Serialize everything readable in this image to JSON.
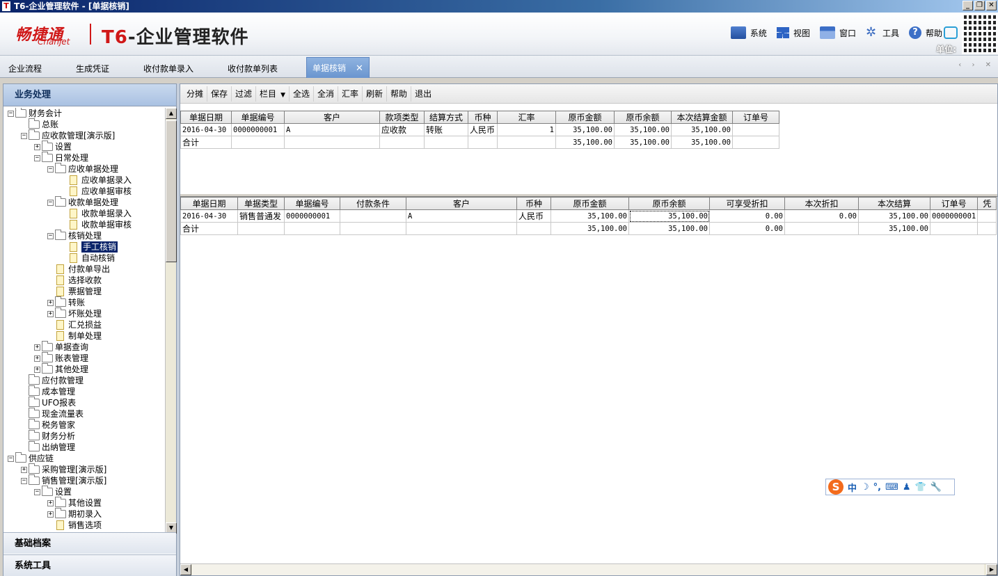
{
  "window": {
    "title": "T6-企业管理软件 - [单据核销]",
    "app_icon": "T",
    "controls": {
      "minimize": "_",
      "restore": "❐",
      "close": "✕"
    }
  },
  "header": {
    "brand_cn": "畅捷通",
    "brand_en": "Chanjet",
    "product_prefix": "T6",
    "product_suffix": "-企业管理软件",
    "menu": [
      {
        "label": "系统",
        "icon": "system-icon"
      },
      {
        "label": "视图",
        "icon": "view-icon"
      },
      {
        "label": "窗口",
        "icon": "window-icon"
      },
      {
        "label": "工具",
        "icon": "tools-icon"
      },
      {
        "label": "帮助",
        "icon": "help-icon"
      }
    ],
    "unit_label": "单位:"
  },
  "tabs": [
    {
      "label": "企业流程"
    },
    {
      "label": "生成凭证"
    },
    {
      "label": "收付款单录入"
    },
    {
      "label": "收付款单列表"
    },
    {
      "label": "单据核销",
      "active": true,
      "close": "✕"
    }
  ],
  "tab_nav": "‹ › ✕",
  "left_panel": {
    "header": "业务处理",
    "tree": [
      {
        "label": "财务会计",
        "level": 0,
        "exp": "-",
        "icon": "folder"
      },
      {
        "label": "总账",
        "level": 1,
        "exp": "",
        "icon": "folder"
      },
      {
        "label": "应收款管理[演示版]",
        "level": 1,
        "exp": "-",
        "icon": "folder"
      },
      {
        "label": "设置",
        "level": 2,
        "exp": "+",
        "icon": "folder"
      },
      {
        "label": "日常处理",
        "level": 2,
        "exp": "-",
        "icon": "folder"
      },
      {
        "label": "应收单据处理",
        "level": 3,
        "exp": "-",
        "icon": "folder"
      },
      {
        "label": "应收单据录入",
        "level": 4,
        "exp": "",
        "icon": "doc"
      },
      {
        "label": "应收单据审核",
        "level": 4,
        "exp": "",
        "icon": "doc"
      },
      {
        "label": "收款单据处理",
        "level": 3,
        "exp": "-",
        "icon": "folder"
      },
      {
        "label": "收款单据录入",
        "level": 4,
        "exp": "",
        "icon": "doc"
      },
      {
        "label": "收款单据审核",
        "level": 4,
        "exp": "",
        "icon": "doc"
      },
      {
        "label": "核销处理",
        "level": 3,
        "exp": "-",
        "icon": "folder"
      },
      {
        "label": "手工核销",
        "level": 4,
        "exp": "",
        "icon": "doc",
        "selected": true
      },
      {
        "label": "自动核销",
        "level": 4,
        "exp": "",
        "icon": "doc"
      },
      {
        "label": "付款单导出",
        "level": 3,
        "exp": "",
        "icon": "doc"
      },
      {
        "label": "选择收款",
        "level": 3,
        "exp": "",
        "icon": "doc"
      },
      {
        "label": "票据管理",
        "level": 3,
        "exp": "",
        "icon": "doc"
      },
      {
        "label": "转账",
        "level": 3,
        "exp": "+",
        "icon": "folder"
      },
      {
        "label": "坏账处理",
        "level": 3,
        "exp": "+",
        "icon": "folder"
      },
      {
        "label": "汇兑损益",
        "level": 3,
        "exp": "",
        "icon": "doc"
      },
      {
        "label": "制单处理",
        "level": 3,
        "exp": "",
        "icon": "doc"
      },
      {
        "label": "单据查询",
        "level": 2,
        "exp": "+",
        "icon": "folder"
      },
      {
        "label": "账表管理",
        "level": 2,
        "exp": "+",
        "icon": "folder"
      },
      {
        "label": "其他处理",
        "level": 2,
        "exp": "+",
        "icon": "folder"
      },
      {
        "label": "应付款管理",
        "level": 1,
        "exp": "",
        "icon": "folder"
      },
      {
        "label": "成本管理",
        "level": 1,
        "exp": "",
        "icon": "folder"
      },
      {
        "label": "UFO报表",
        "level": 1,
        "exp": "",
        "icon": "folder"
      },
      {
        "label": "现金流量表",
        "level": 1,
        "exp": "",
        "icon": "folder"
      },
      {
        "label": "税务管家",
        "level": 1,
        "exp": "",
        "icon": "folder"
      },
      {
        "label": "财务分析",
        "level": 1,
        "exp": "",
        "icon": "folder"
      },
      {
        "label": "出纳管理",
        "level": 1,
        "exp": "",
        "icon": "folder"
      },
      {
        "label": "供应链",
        "level": 0,
        "exp": "-",
        "icon": "folder"
      },
      {
        "label": "采购管理[演示版]",
        "level": 1,
        "exp": "+",
        "icon": "folder"
      },
      {
        "label": "销售管理[演示版]",
        "level": 1,
        "exp": "-",
        "icon": "folder"
      },
      {
        "label": "设置",
        "level": 2,
        "exp": "-",
        "icon": "folder"
      },
      {
        "label": "其他设置",
        "level": 3,
        "exp": "+",
        "icon": "folder"
      },
      {
        "label": "期初录入",
        "level": 3,
        "exp": "+",
        "icon": "folder"
      },
      {
        "label": "销售选项",
        "level": 3,
        "exp": "",
        "icon": "doc"
      }
    ],
    "sections": [
      {
        "label": "基础档案"
      },
      {
        "label": "系统工具"
      }
    ]
  },
  "toolbar": {
    "buttons": [
      "分摊",
      "保存",
      "过滤",
      "栏目",
      "全选",
      "全消",
      "汇率",
      "刷新",
      "帮助",
      "退出"
    ]
  },
  "grid_top": {
    "columns": [
      "单据日期",
      "单据编号",
      "客户",
      "款项类型",
      "结算方式",
      "币种",
      "汇率",
      "原币金额",
      "原币余额",
      "本次结算金额",
      "订单号"
    ],
    "rows": [
      [
        "2016-04-30",
        "0000000001",
        "A",
        "应收款",
        "转账",
        "人民币",
        "1",
        "35,100.00",
        "35,100.00",
        "35,100.00",
        ""
      ],
      [
        "合计",
        "",
        "",
        "",
        "",
        "",
        "",
        "35,100.00",
        "35,100.00",
        "35,100.00",
        ""
      ]
    ]
  },
  "grid_bottom": {
    "columns": [
      "单据日期",
      "单据类型",
      "单据编号",
      "付款条件",
      "客户",
      "币种",
      "原币金额",
      "原币余额",
      "可享受折扣",
      "本次折扣",
      "本次结算",
      "订单号",
      "凭"
    ],
    "rows": [
      [
        "2016-04-30",
        "销售普通发",
        "0000000001",
        "",
        "A",
        "人民币",
        "35,100.00",
        "35,100.00",
        "0.00",
        "0.00",
        "35,100.00",
        "0000000001",
        ""
      ],
      [
        "合计",
        "",
        "",
        "",
        "",
        "",
        "35,100.00",
        "35,100.00",
        "0.00",
        "",
        "35,100.00",
        "",
        ""
      ]
    ]
  },
  "ime": {
    "logo": "S",
    "items": [
      "中",
      "☽",
      "°,",
      "⌨",
      "♟",
      "👕",
      "🔧"
    ]
  }
}
